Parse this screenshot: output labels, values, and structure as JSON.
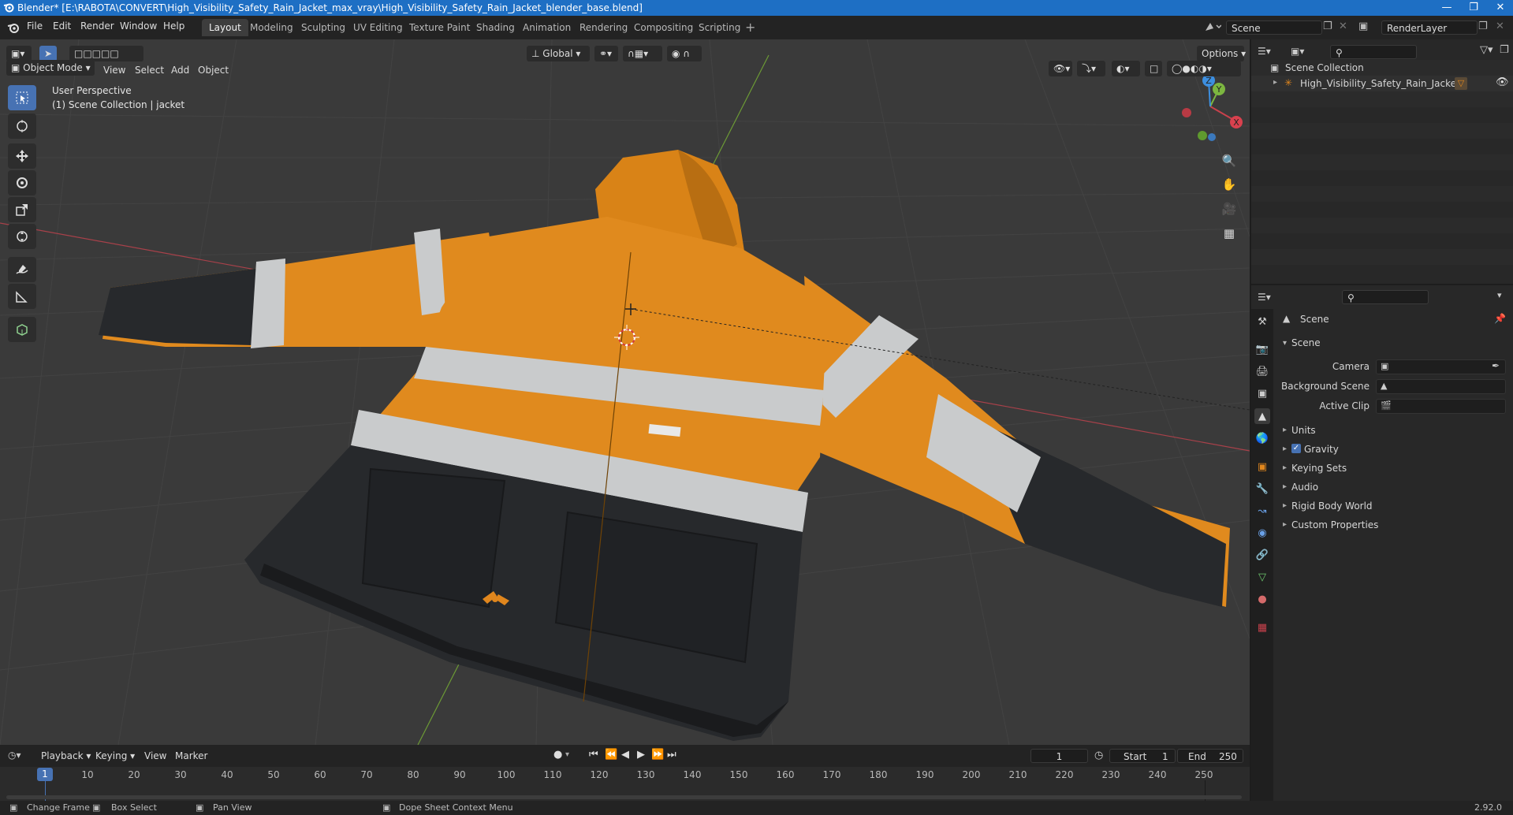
{
  "title_bar": {
    "text": "Blender* [E:\\RABOTA\\CONVERT\\High_Visibility_Safety_Rain_Jacket_max_vray\\High_Visibility_Safety_Rain_Jacket_blender_base.blend]"
  },
  "menu": [
    "File",
    "Edit",
    "Render",
    "Window",
    "Help"
  ],
  "workspaces": [
    {
      "label": "Layout",
      "active": true
    },
    {
      "label": "Modeling"
    },
    {
      "label": "Sculpting"
    },
    {
      "label": "UV Editing"
    },
    {
      "label": "Texture Paint"
    },
    {
      "label": "Shading"
    },
    {
      "label": "Animation"
    },
    {
      "label": "Rendering"
    },
    {
      "label": "Compositing"
    },
    {
      "label": "Scripting"
    }
  ],
  "scene_field": "Scene",
  "renderlayer_field": "RenderLayer",
  "viewport_header": {
    "mode": "Object Mode",
    "menus": [
      "View",
      "Select",
      "Add",
      "Object"
    ],
    "orientation": "Global",
    "options": "Options"
  },
  "viewport_overlay": {
    "line1": "User Perspective",
    "line2": "(1) Scene Collection | jacket"
  },
  "gizmo_axes": {
    "x": "X",
    "y": "Y",
    "z": "Z"
  },
  "outliner": {
    "root": "Scene Collection",
    "items": [
      {
        "label": "High_Visibility_Safety_Rain_Jacket"
      }
    ]
  },
  "properties": {
    "breadcrumb": "Scene",
    "section": "Scene",
    "fields": [
      {
        "label": "Camera"
      },
      {
        "label": "Background Scene"
      },
      {
        "label": "Active Clip"
      }
    ],
    "panels": [
      {
        "label": "Units",
        "checkbox": false
      },
      {
        "label": "Gravity",
        "checkbox": true
      },
      {
        "label": "Keying Sets",
        "checkbox": false
      },
      {
        "label": "Audio",
        "checkbox": false
      },
      {
        "label": "Rigid Body World",
        "checkbox": false
      },
      {
        "label": "Custom Properties",
        "checkbox": false
      }
    ]
  },
  "timeline": {
    "menus": [
      "Playback",
      "Keying",
      "View",
      "Marker"
    ],
    "current_frame": "1",
    "start_label": "Start",
    "start": "1",
    "end_label": "End",
    "end": "250",
    "ruler": [
      "1",
      "10",
      "20",
      "30",
      "40",
      "50",
      "60",
      "70",
      "80",
      "90",
      "100",
      "110",
      "120",
      "130",
      "140",
      "150",
      "160",
      "170",
      "180",
      "190",
      "200",
      "210",
      "220",
      "230",
      "240",
      "250"
    ]
  },
  "statusbar": {
    "items": [
      "Change Frame",
      "Box Select",
      "Pan View",
      "Dope Sheet Context Menu"
    ],
    "version": "2.92.0"
  },
  "colors": {
    "accent": "#4772b3",
    "titlebar": "#1e6fc4",
    "jacket_orange": "#e08a1e",
    "jacket_black": "#27292c",
    "reflective": "#c9cbcc",
    "axis_x": "#c8414c",
    "axis_y": "#7cb640",
    "axis_z": "#3d8fe0"
  }
}
